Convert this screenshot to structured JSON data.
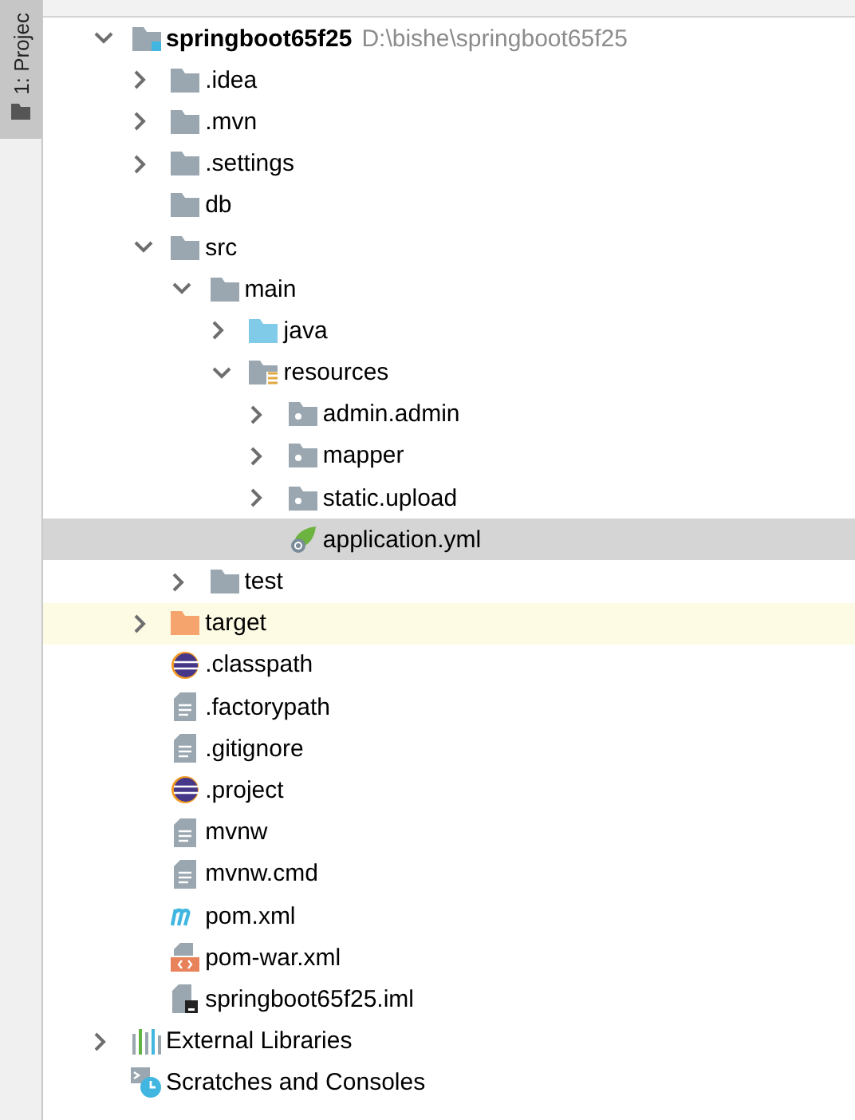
{
  "side_tab": {
    "label": "1: Projec",
    "selected": true
  },
  "tree": [
    {
      "label": "springboot65f25",
      "path": "D:\\bishe\\springboot65f25",
      "kind": "module",
      "expanded": true,
      "selected": false,
      "children": [
        {
          "label": ".idea",
          "kind": "folder",
          "expanded": false,
          "selected": false
        },
        {
          "label": ".mvn",
          "kind": "folder",
          "expanded": false,
          "selected": false
        },
        {
          "label": ".settings",
          "kind": "folder",
          "expanded": false,
          "selected": false
        },
        {
          "label": "db",
          "kind": "folder",
          "selected": false
        },
        {
          "label": "src",
          "kind": "folder",
          "expanded": true,
          "selected": false,
          "children": [
            {
              "label": "main",
              "kind": "folder",
              "expanded": true,
              "selected": false,
              "children": [
                {
                  "label": "java",
                  "kind": "source-folder",
                  "expanded": false,
                  "selected": false
                },
                {
                  "label": "resources",
                  "kind": "resources-folder",
                  "expanded": true,
                  "selected": false,
                  "children": [
                    {
                      "label": "admin.admin",
                      "kind": "package",
                      "expanded": false,
                      "selected": false
                    },
                    {
                      "label": "mapper",
                      "kind": "package",
                      "expanded": false,
                      "selected": false
                    },
                    {
                      "label": "static.upload",
                      "kind": "package",
                      "expanded": false,
                      "selected": false
                    },
                    {
                      "label": "application.yml",
                      "kind": "spring-config",
                      "selected": true
                    }
                  ]
                }
              ]
            },
            {
              "label": "test",
              "kind": "folder",
              "expanded": false,
              "selected": false
            }
          ]
        },
        {
          "label": "target",
          "kind": "excluded-folder",
          "expanded": false,
          "selected": false
        },
        {
          "label": ".classpath",
          "kind": "eclipse",
          "selected": false
        },
        {
          "label": ".factorypath",
          "kind": "text",
          "selected": false
        },
        {
          "label": ".gitignore",
          "kind": "text",
          "selected": false
        },
        {
          "label": ".project",
          "kind": "eclipse",
          "selected": false
        },
        {
          "label": "mvnw",
          "kind": "text",
          "selected": false
        },
        {
          "label": "mvnw.cmd",
          "kind": "text",
          "selected": false
        },
        {
          "label": "pom.xml",
          "kind": "maven",
          "selected": false
        },
        {
          "label": "pom-war.xml",
          "kind": "xml",
          "selected": false
        },
        {
          "label": "springboot65f25.iml",
          "kind": "iml",
          "selected": false
        }
      ]
    },
    {
      "label": "External Libraries",
      "kind": "libraries",
      "expanded": false,
      "selected": false
    },
    {
      "label": "Scratches and Consoles",
      "kind": "scratches",
      "selected": false
    }
  ]
}
